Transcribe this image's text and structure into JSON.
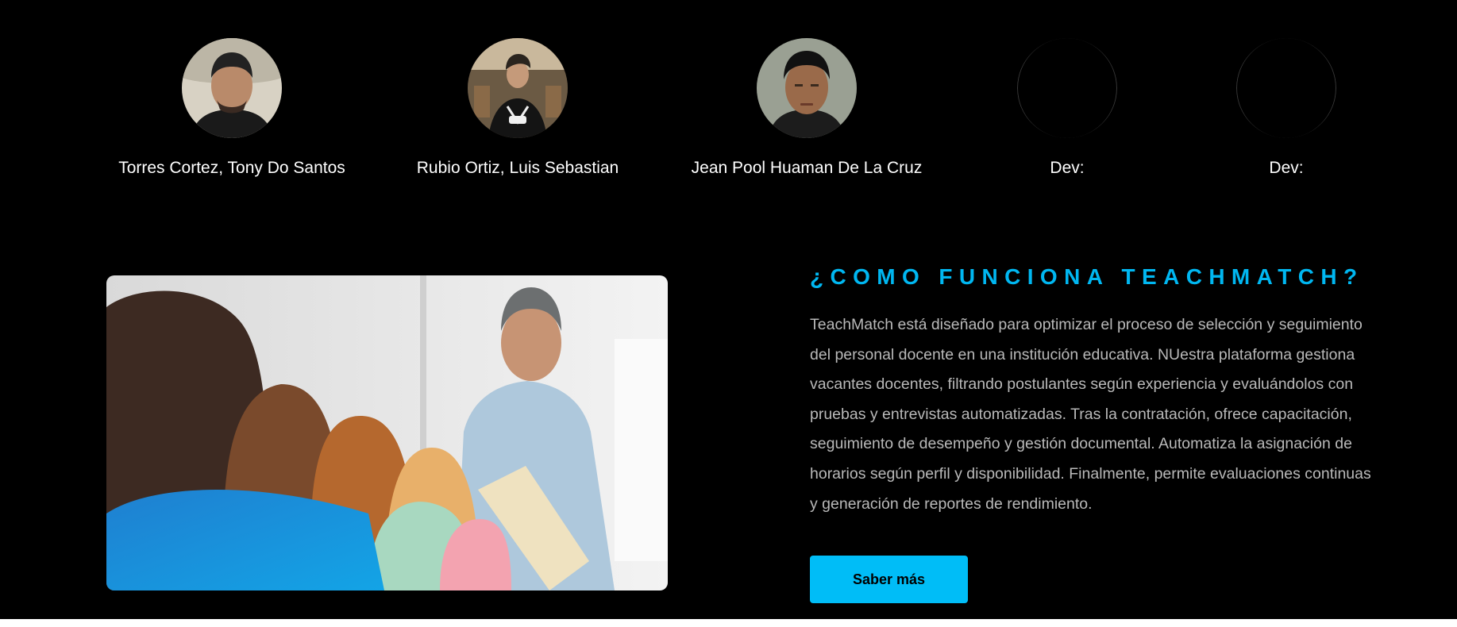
{
  "team": {
    "members": [
      {
        "name": "Torres Cortez, Tony Do Santos",
        "photo": "profile-photo"
      },
      {
        "name": "Rubio Ortiz, Luis Sebastian",
        "photo": "profile-photo"
      },
      {
        "name": "Jean Pool Huaman De La Cruz",
        "photo": "profile-photo"
      },
      {
        "name": "Dev:",
        "photo": "broken-image"
      },
      {
        "name": "Dev:",
        "photo": "broken-image"
      }
    ]
  },
  "about": {
    "title": "¿COMO FUNCIONA TEACHMATCH?",
    "description": "TeachMatch está diseñado para optimizar el proceso de selección y seguimiento del personal docente en una institución educativa. NUestra plataforma gestiona vacantes docentes, filtrando postulantes según experiencia y evaluándolos con pruebas y entrevistas automatizadas. Tras la contratación, ofrece capacitación, seguimiento de desempeño y gestión documental. Automatiza la asignación de horarios según perfil y disponibilidad. Finalmente, permite evaluaciones continuas y generación de reportes de rendimiento.",
    "button_label": "Saber más",
    "image": "classroom-teacher-photo"
  },
  "colors": {
    "background": "#000000",
    "accent": "#00b7f1",
    "button": "#00bdf7",
    "body_text": "#b9b9b9"
  }
}
